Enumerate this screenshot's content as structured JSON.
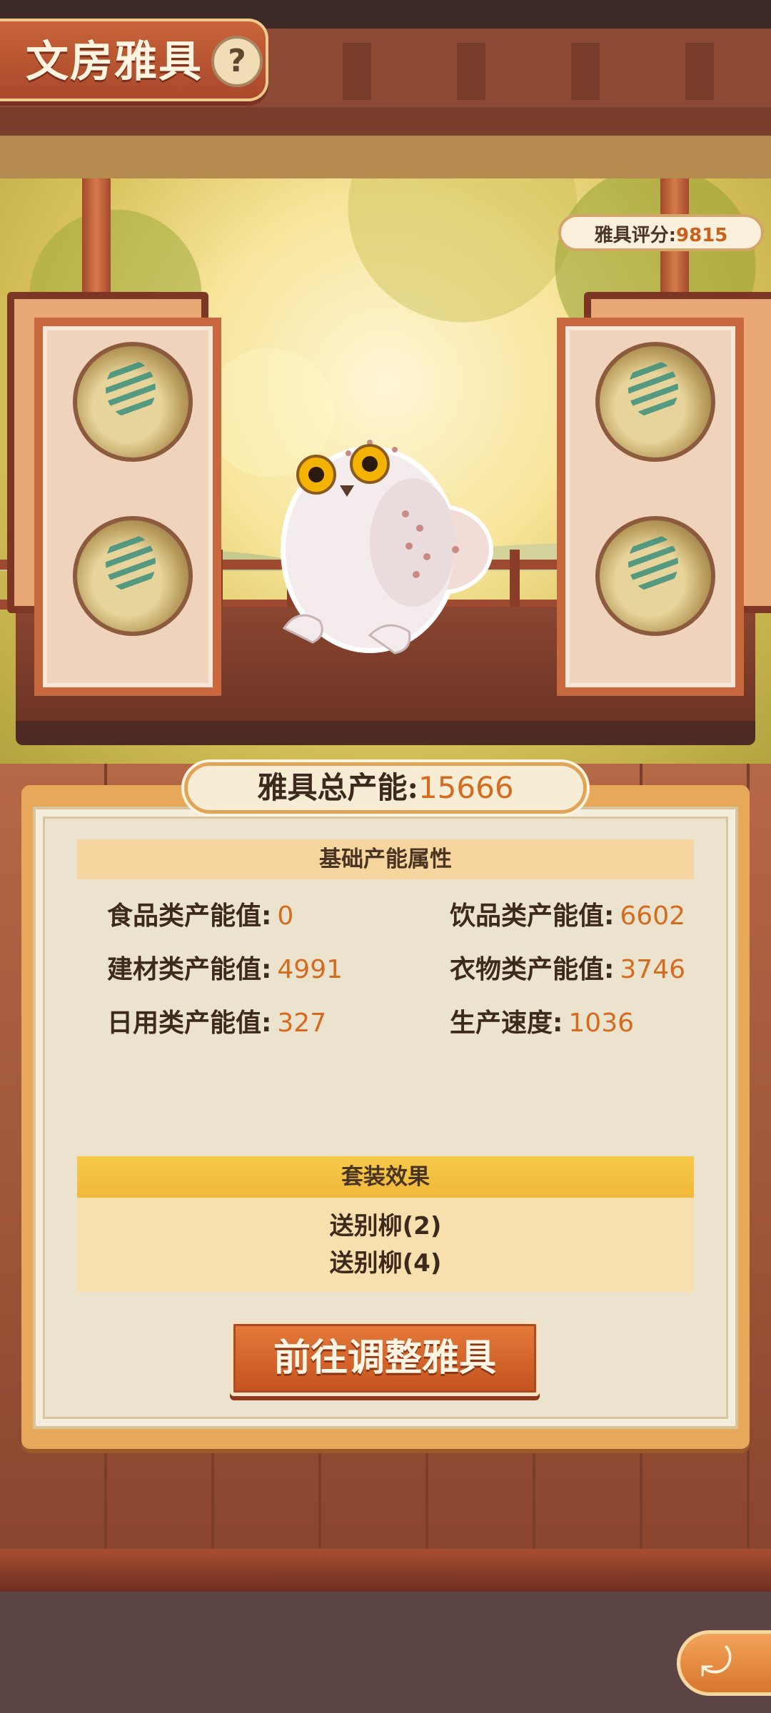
{
  "header": {
    "title": "文房雅具",
    "help_icon": "?"
  },
  "scene": {
    "score_label": "雅具评分:",
    "score_value": "9815"
  },
  "panel": {
    "total_label": "雅具总产能:",
    "total_value": "15666",
    "base_section_title": "基础产能属性",
    "stats": {
      "food_label": "食品类产能值:",
      "food_value": "0",
      "drink_label": "饮品类产能值:",
      "drink_value": "6602",
      "material_label": "建材类产能值:",
      "material_value": "4991",
      "clothing_label": "衣物类产能值:",
      "clothing_value": "3746",
      "daily_label": "日用类产能值:",
      "daily_value": "327",
      "speed_label": "生产速度:",
      "speed_value": "1036"
    },
    "set_section_title": "套装效果",
    "set_effects": [
      "送别柳(2)",
      "送别柳(4)"
    ],
    "adjust_button": "前往调整雅具"
  },
  "footer": {
    "back_icon": "back-arrow-icon"
  },
  "colors": {
    "accent": "#d46b1f",
    "button": "#c8582a",
    "panel": "#ece3cf"
  }
}
